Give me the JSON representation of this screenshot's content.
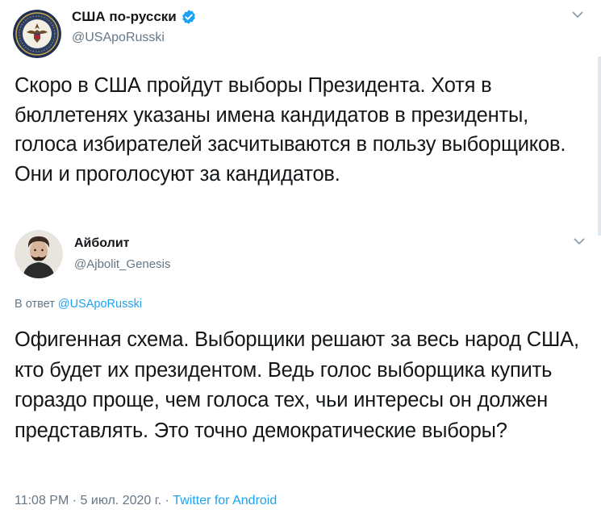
{
  "original_tweet": {
    "display_name": "США по-русски",
    "handle": "@USApoRusski",
    "verified": true,
    "text": "Скоро в США пройдут выборы Президента. Хотя в бюллетенях указаны имена кандидатов в президенты, голоса избирателей засчитываются в пользу выборщиков. Они и проголосуют за кандидатов."
  },
  "reply_tweet": {
    "display_name": "Айболит",
    "handle": "@Ajbolit_Genesis",
    "reply_prefix": "В ответ",
    "reply_mention": "@USApoRusski",
    "text": "Офигенная схема. Выборщики решают за весь народ США, кто будет их президентом. Ведь голос выборщика купить гораздо проще, чем голоса тех, чьи интересы он должен представлять. Это точно демократические выборы?",
    "time": "11:08 PM",
    "date": "5 июл. 2020 г.",
    "source": "Twitter for Android"
  },
  "colors": {
    "accent": "#1da1f2",
    "secondary_text": "#657786",
    "primary_text": "#14171a"
  },
  "icons": [
    "state-dept-seal-avatar",
    "verified-badge-icon",
    "chevron-down-icon",
    "user-avatar"
  ]
}
